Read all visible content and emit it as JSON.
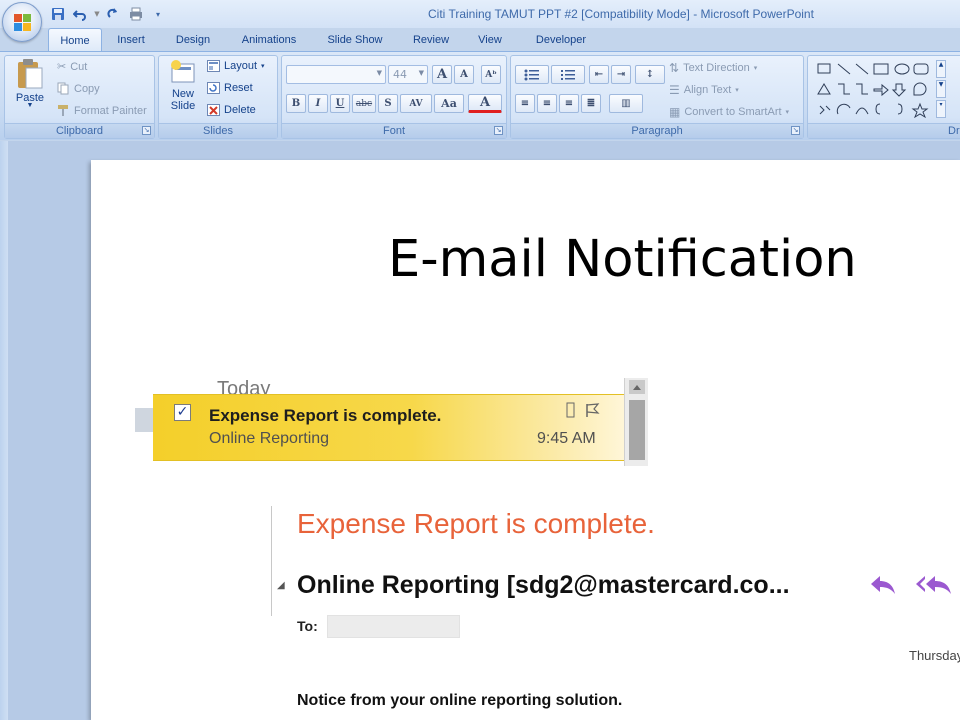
{
  "window": {
    "title": "Citi Training TAMUT PPT #2 [Compatibility Mode]",
    "separator": " - ",
    "app_name": "Microsoft PowerPoint"
  },
  "qat": {
    "icons": [
      "save-icon",
      "undo-icon",
      "redo-icon",
      "print-preview-icon",
      "customize-qat-icon"
    ]
  },
  "tabs": [
    "Home",
    "Insert",
    "Design",
    "Animations",
    "Slide Show",
    "Review",
    "View",
    "Developer"
  ],
  "active_tab": "Home",
  "ribbon": {
    "clipboard": {
      "label": "Clipboard",
      "paste": "Paste",
      "cut": "Cut",
      "copy": "Copy",
      "format_painter": "Format Painter"
    },
    "slides": {
      "label": "Slides",
      "new_slide_line1": "New",
      "new_slide_line2": "Slide",
      "layout": "Layout",
      "reset": "Reset",
      "delete": "Delete"
    },
    "font": {
      "label": "Font",
      "font_name": "",
      "font_size": "44",
      "grow": "A",
      "shrink": "A",
      "bold": "B",
      "italic": "I",
      "underline": "U",
      "strike": "abc",
      "shadow": "S",
      "spacing": "AV",
      "change_case": "Aa",
      "font_color": "A"
    },
    "paragraph": {
      "label": "Paragraph",
      "text_direction": "Text Direction",
      "align_text": "Align Text",
      "convert_smartart": "Convert to SmartArt"
    },
    "drawing": {
      "label": "Dr"
    }
  },
  "slide": {
    "title": "E-mail Notification",
    "outlook_item": {
      "group_header": "Today",
      "subject": "Expense Report is complete.",
      "sender": "Online Reporting",
      "time": "9:45 AM",
      "checked": true
    },
    "email": {
      "subject": "Expense Report is complete.",
      "from": "Online Reporting [sdg2@mastercard.co...",
      "to_label": "To:",
      "date": "Thursday",
      "body": "Notice from your online reporting solution."
    }
  },
  "colors": {
    "ribbon_text": "#15428b",
    "subject_orange": "#e8633a",
    "highlight_yellow": "#f4cf2a",
    "reply_purple": "#9b59d0"
  }
}
